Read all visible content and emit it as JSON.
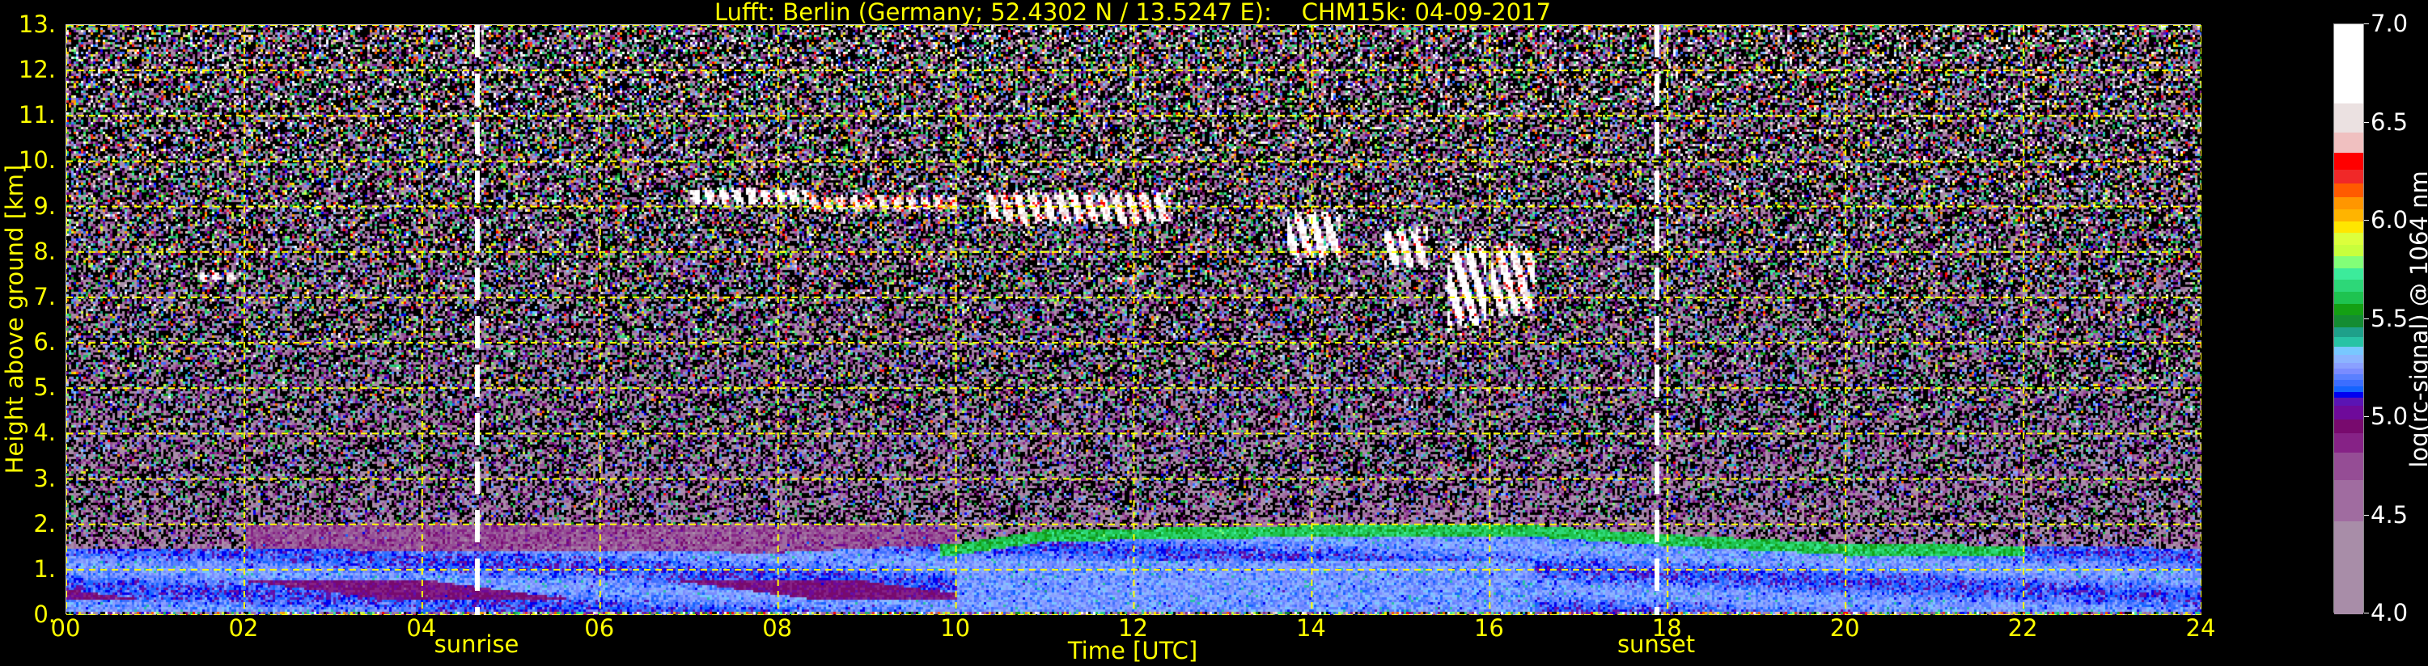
{
  "chart_data": {
    "type": "heatmap",
    "title": "Lufft: Berlin (Germany; 52.4302 N / 13.5247 E):    CHM15k: 04-09-2017",
    "xlabel": "Time [UTC]",
    "ylabel": "Height above ground [km]",
    "xlim": [
      0,
      24
    ],
    "ylim": [
      0,
      13
    ],
    "x_ticks": [
      0,
      2,
      4,
      6,
      8,
      10,
      12,
      14,
      16,
      18,
      20,
      22,
      24
    ],
    "x_tick_labels": [
      "00",
      "02",
      "04",
      "06",
      "08",
      "10",
      "12",
      "14",
      "16",
      "18",
      "20",
      "22",
      "24"
    ],
    "y_ticks": [
      0,
      1,
      2,
      3,
      4,
      5,
      6,
      7,
      8,
      9,
      10,
      11,
      12,
      13
    ],
    "y_tick_labels": [
      "0.",
      "1.",
      "2.",
      "3.",
      "4.",
      "5.",
      "6.",
      "7.",
      "8.",
      "9.",
      "10.",
      "11.",
      "12.",
      "13."
    ],
    "grid": true,
    "grid_color": "#ffff00",
    "markers": [
      {
        "label": "sunrise",
        "time_h": 4.62
      },
      {
        "label": "sunset",
        "time_h": 17.88
      }
    ],
    "colorbar": {
      "label": "log(rc-signal) @ 1064 nm",
      "range": [
        4.0,
        7.0
      ],
      "ticks": [
        4.0,
        4.5,
        5.0,
        5.5,
        6.0,
        6.5,
        7.0
      ],
      "tick_labels": [
        "4.0",
        "4.5",
        "5.0",
        "5.5",
        "6.0",
        "6.5",
        "7.0"
      ],
      "bins": [
        {
          "from": 4.0,
          "to": 4.47,
          "color": "#a88da8"
        },
        {
          "from": 4.47,
          "to": 4.68,
          "color": "#a06ca0"
        },
        {
          "from": 4.68,
          "to": 4.82,
          "color": "#954d95"
        },
        {
          "from": 4.82,
          "to": 4.92,
          "color": "#862286"
        },
        {
          "from": 4.92,
          "to": 4.99,
          "color": "#780a6e"
        },
        {
          "from": 4.99,
          "to": 5.06,
          "color": "#6e0a9a"
        },
        {
          "from": 5.06,
          "to": 5.1,
          "color": "#5a14b4"
        },
        {
          "from": 5.1,
          "to": 5.13,
          "color": "#0000f0"
        },
        {
          "from": 5.13,
          "to": 5.16,
          "color": "#1464ff"
        },
        {
          "from": 5.16,
          "to": 5.19,
          "color": "#3c6eff"
        },
        {
          "from": 5.19,
          "to": 5.22,
          "color": "#5a80ff"
        },
        {
          "from": 5.22,
          "to": 5.25,
          "color": "#7a8cff"
        },
        {
          "from": 5.25,
          "to": 5.28,
          "color": "#8aa0ff"
        },
        {
          "from": 5.28,
          "to": 5.32,
          "color": "#8cb4ff"
        },
        {
          "from": 5.32,
          "to": 5.36,
          "color": "#78c8ff"
        },
        {
          "from": 5.36,
          "to": 5.41,
          "color": "#28c3a5"
        },
        {
          "from": 5.41,
          "to": 5.46,
          "color": "#1ea08a"
        },
        {
          "from": 5.46,
          "to": 5.52,
          "color": "#148c32"
        },
        {
          "from": 5.52,
          "to": 5.58,
          "color": "#14a014"
        },
        {
          "from": 5.58,
          "to": 5.64,
          "color": "#1ec350"
        },
        {
          "from": 5.64,
          "to": 5.7,
          "color": "#2dd778"
        },
        {
          "from": 5.7,
          "to": 5.76,
          "color": "#3ceb9b"
        },
        {
          "from": 5.76,
          "to": 5.82,
          "color": "#82ff78"
        },
        {
          "from": 5.82,
          "to": 5.88,
          "color": "#c8ff3c"
        },
        {
          "from": 5.88,
          "to": 5.94,
          "color": "#dcff3c"
        },
        {
          "from": 5.94,
          "to": 6.0,
          "color": "#ffe600"
        },
        {
          "from": 6.0,
          "to": 6.06,
          "color": "#ffb400"
        },
        {
          "from": 6.06,
          "to": 6.12,
          "color": "#ff9600"
        },
        {
          "from": 6.12,
          "to": 6.19,
          "color": "#ff5a00"
        },
        {
          "from": 6.19,
          "to": 6.26,
          "color": "#f02828"
        },
        {
          "from": 6.26,
          "to": 6.35,
          "color": "#ff0000"
        },
        {
          "from": 6.35,
          "to": 6.45,
          "color": "#f0c0c0"
        },
        {
          "from": 6.45,
          "to": 6.6,
          "color": "#ebe1e1"
        },
        {
          "from": 6.6,
          "to": 7.0,
          "color": "#ffffff"
        }
      ]
    },
    "boundary_layer_top_km": [
      {
        "t": 0,
        "h": 1.5
      },
      {
        "t": 4,
        "h": 1.45
      },
      {
        "t": 8,
        "h": 1.4
      },
      {
        "t": 10,
        "h": 1.6
      },
      {
        "t": 11,
        "h": 1.9
      },
      {
        "t": 14,
        "h": 2.0
      },
      {
        "t": 16.5,
        "h": 2.0
      },
      {
        "t": 18,
        "h": 1.8
      },
      {
        "t": 20,
        "h": 1.6
      },
      {
        "t": 24,
        "h": 1.5
      }
    ],
    "residual_layer": {
      "t0": 2.0,
      "t1": 10.0,
      "h0": 1.4,
      "h1": 2.0,
      "value": 4.75
    },
    "clouds": [
      {
        "t0": 1.5,
        "t1": 1.95,
        "h0": 7.35,
        "h1": 7.6,
        "value": 6.7
      },
      {
        "t0": 7.0,
        "t1": 8.3,
        "h0": 9.05,
        "h1": 9.45,
        "value": 6.8
      },
      {
        "t0": 8.3,
        "t1": 10.0,
        "h0": 8.9,
        "h1": 9.3,
        "value": 6.5
      },
      {
        "t0": 10.3,
        "t1": 12.4,
        "h0": 8.6,
        "h1": 9.4,
        "value": 6.7
      },
      {
        "t0": 11.8,
        "t1": 12.0,
        "h0": 7.3,
        "h1": 7.5,
        "value": 6.6
      },
      {
        "t0": 13.7,
        "t1": 14.3,
        "h0": 7.8,
        "h1": 9.0,
        "value": 6.8
      },
      {
        "t0": 14.8,
        "t1": 15.3,
        "h0": 7.6,
        "h1": 8.6,
        "value": 6.8
      },
      {
        "t0": 15.5,
        "t1": 15.95,
        "h0": 6.2,
        "h1": 8.4,
        "value": 6.9
      },
      {
        "t0": 16.0,
        "t1": 16.5,
        "h0": 6.5,
        "h1": 8.3,
        "value": 6.7
      }
    ],
    "noise_floor_value": 4.3
  }
}
